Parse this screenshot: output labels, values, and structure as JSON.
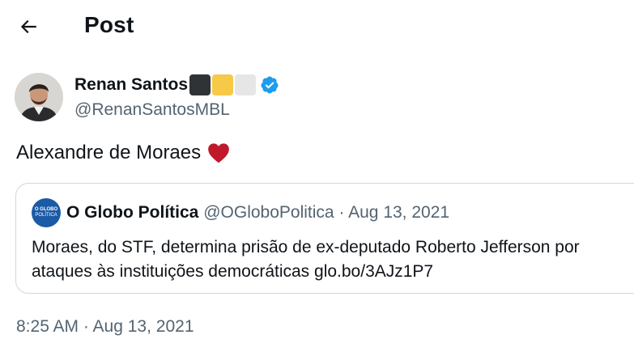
{
  "header": {
    "title": "Post",
    "back_icon": "arrow-left-icon"
  },
  "post": {
    "author_name": "Renan Santos",
    "author_handle": "@RenanSantosMBL",
    "badge_colors": [
      "#2f3336",
      "#f7c948",
      "#e6e6e6"
    ],
    "verified_color": "#1d9bf0",
    "text": "Alexandre de Moraes",
    "heart_color": "#c0192b",
    "timestamp": "8:25 AM · Aug 13, 2021"
  },
  "quote": {
    "author_name": "O Globo Política",
    "author_handle": "@OGloboPolitica",
    "separator": "·",
    "date": "Aug 13, 2021",
    "logo_line1": "O GLOBO",
    "logo_line2": "POLÍTICA",
    "line1": "Moraes, do STF, determina prisão de ex-deputado Roberto Jefferson por",
    "line2": "ataques às instituições democráticas  glo.bo/3AJz1P7"
  }
}
